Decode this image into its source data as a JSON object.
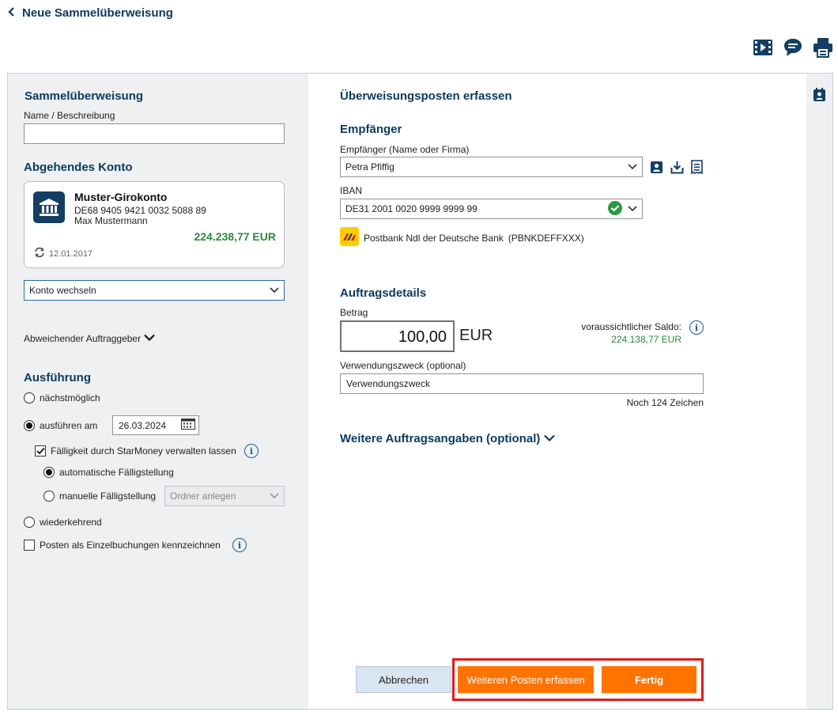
{
  "header": {
    "back_title": "Neue Sammelüberweisung"
  },
  "left": {
    "section_title": "Sammelüberweisung",
    "name_label": "Name / Beschreibung",
    "name_value": "",
    "account_title": "Abgehendes Konto",
    "account": {
      "name": "Muster-Girokonto",
      "iban": "DE68 9405 9421 0032 5088 89",
      "owner": "Max Mustermann",
      "balance": "224.238,77 EUR",
      "date": "12.01.2017"
    },
    "switch_account": "Konto wechseln",
    "other_payer": "Abweichender Auftraggeber",
    "execution_title": "Ausführung",
    "opt_next": "nächstmöglich",
    "opt_on_date": "ausführen am",
    "date_value": "26.03.2024",
    "due_check": "Fälligkeit durch StarMoney verwalten lassen",
    "auto_due": "automatische Fälligstellung",
    "manual_due": "manuelle Fälligstellung",
    "folder_select": "Ordner anlegen",
    "recurring": "wiederkehrend",
    "single_bookings": "Posten als Einzelbuchungen kennzeichnen"
  },
  "right": {
    "title": "Überweisungsposten erfassen",
    "recipient_title": "Empfänger",
    "recipient_label": "Empfänger (Name oder Firma)",
    "recipient_value": "Petra Pfiffig",
    "iban_label": "IBAN",
    "iban_value": "DE31 2001 0020 9999 9999 99",
    "bank": "Postbank Ndl der Deutsche Bank",
    "bic": "(PBNKDEFFXXX)",
    "details_title": "Auftragsdetails",
    "amount_label": "Betrag",
    "amount_value": "100,00",
    "currency": "EUR",
    "expected_balance_label": "voraussichtlicher Saldo:",
    "expected_balance_value": "224.138,77 EUR",
    "purpose_label": "Verwendungszweck (optional)",
    "purpose_placeholder": "Verwendungszweck",
    "chars_left": "Noch 124 Zeichen",
    "more_details": "Weitere Auftragsangaben (optional)"
  },
  "buttons": {
    "cancel": "Abbrechen",
    "add_more": "Weiteren Posten erfassen",
    "done": "Fertig"
  },
  "colors": {
    "brand": "#0b3a5e",
    "positive": "#2a8a3c",
    "action": "#ff7300",
    "highlight": "#e01b1b"
  },
  "icons": [
    "chevron-left-icon",
    "video-icon",
    "chat-icon",
    "print-icon",
    "contact-card-icon",
    "bank-icon",
    "refresh-icon",
    "calendar-icon",
    "checkmark-icon",
    "chevron-down-icon",
    "info-icon",
    "download-icon",
    "receipt-icon",
    "postbank-logo"
  ]
}
